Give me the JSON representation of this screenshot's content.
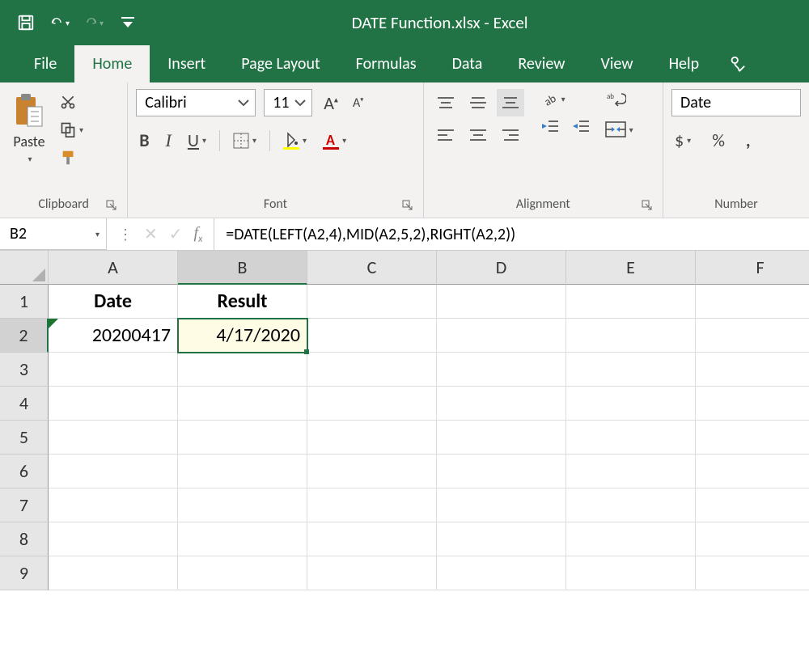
{
  "title": {
    "filename": "DATE Function.xlsx",
    "separator": " - ",
    "appname": "Excel"
  },
  "tabs": {
    "file": "File",
    "home": "Home",
    "insert": "Insert",
    "page_layout": "Page Layout",
    "formulas": "Formulas",
    "data": "Data",
    "review": "Review",
    "view": "View",
    "help": "Help"
  },
  "ribbon": {
    "clipboard": {
      "paste": "Paste",
      "label": "Clipboard"
    },
    "font": {
      "name": "Calibri",
      "size": "11",
      "bold": "B",
      "italic": "I",
      "underline": "U",
      "label": "Font"
    },
    "alignment": {
      "label": "Alignment"
    },
    "number": {
      "format": "Date",
      "currency": "$",
      "percent": "%",
      "comma": ",",
      "label": "Number"
    }
  },
  "formula_bar": {
    "namebox": "B2",
    "formula": "=DATE(LEFT(A2,4),MID(A2,5,2),RIGHT(A2,2))"
  },
  "grid": {
    "cols": [
      "A",
      "B",
      "C",
      "D",
      "E",
      "F"
    ],
    "rows": [
      "1",
      "2",
      "3",
      "4",
      "5",
      "6",
      "7",
      "8",
      "9"
    ],
    "A1": "Date",
    "B1": "Result",
    "A2": "20200417",
    "B2": "4/17/2020",
    "selected": "B2"
  }
}
